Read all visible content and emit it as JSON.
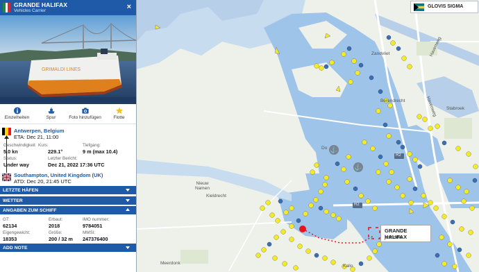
{
  "panel": {
    "vessel_name": "GRANDE HALIFAX",
    "vessel_type": "Vehicles Carrier",
    "close_symbol": "×",
    "flag_colors": [
      "#1c8b3a",
      "#ffffff",
      "#cf2b37"
    ],
    "toolbar": [
      {
        "label": "Einzelheiten",
        "icon": "info-icon"
      },
      {
        "label": "Spur",
        "icon": "ship-icon"
      },
      {
        "label": "Foto hinzufügen",
        "icon": "camera-icon"
      },
      {
        "label": "Flotte",
        "icon": "star-icon"
      }
    ],
    "destination": {
      "place": "Antwerpen, Belgium",
      "eta": "ETA: Dec 21, 11:00"
    },
    "origin": {
      "place": "Southampton, United Kingdom (UK)",
      "atd": "ATD: Dec 20, 21:45 UTC"
    },
    "info": {
      "speed_label": "Geschwindigkeit",
      "speed": "5.0 kn",
      "course_label": "Kurs:",
      "course": "229.1°",
      "draught_label": "Tiefgang:",
      "draught": "9 m (max 10.4)",
      "status_label": "Status:",
      "status": "Under way",
      "report_label": "Letzter Bericht:",
      "report": "Dec 21, 2022 17:36 UTC"
    },
    "sections": {
      "ports": "LETZTE HÄFEN",
      "weather": "WETTER",
      "ship_details": "ANGABEN ZUM SCHIFF",
      "add_note": "ADD NOTE"
    },
    "details": {
      "gt_label": "GT:",
      "gt": "62134",
      "built_label": "Erbaut:",
      "built": "2018",
      "imo_label": "IMO nummer:",
      "imo": "9784051",
      "dwt_label": "Eigengewicht:",
      "dwt": "18353",
      "size_label": "Größe:",
      "size": "200 / 32 m",
      "mmsi_label": "MMSI:",
      "mmsi": "247376400"
    }
  },
  "target_badge": {
    "name": "GLOVIS SIGMA"
  },
  "popup": {
    "name": "GRANDE HALIFAX",
    "time": "just now"
  },
  "map_labels": {
    "zandvliet": "Zandvliet",
    "berendrecht": "Berendrecht",
    "stabroek": "Stabroek",
    "havenweg1": "Havenweg",
    "havenweg2": "Havenweg",
    "nieuw_namen": "Nieuw\nNamen",
    "kieldrecht": "Kieldrecht",
    "meerdonk": "Meerdonk",
    "kallo": "Kallo",
    "do": "Do",
    "r2a": "R2",
    "r2b": "R2"
  },
  "colors": {
    "accent": "#1e5aa8",
    "water": "#9ec4ea",
    "land": "#eef0ea",
    "ship_yellow": "#f2ea2a",
    "ship_blue": "#3d6fb3",
    "own_ship": "#e8141b"
  }
}
